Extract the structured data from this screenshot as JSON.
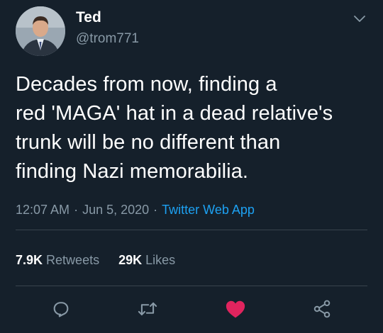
{
  "user": {
    "display_name": "Ted",
    "handle": "@trom771"
  },
  "tweet": {
    "text": "Decades from now, finding a\nred 'MAGA' hat in a dead relative's\ntrunk will be no different than\nfinding Nazi memorabilia.",
    "time": "12:07 AM",
    "separator": "·",
    "date": "Jun 5, 2020",
    "source": "Twitter Web App"
  },
  "stats": {
    "retweets_count": "7.9K",
    "retweets_label": "Retweets",
    "likes_count": "29K",
    "likes_label": "Likes"
  },
  "actions": [
    {
      "icon": "reply-icon"
    },
    {
      "icon": "retweet-icon"
    },
    {
      "icon": "like-heart-icon",
      "state": "liked"
    },
    {
      "icon": "share-icon"
    }
  ],
  "colors": {
    "background": "#15202b",
    "text_primary": "#ffffff",
    "text_secondary": "#8899a6",
    "link": "#1da1f2",
    "like": "#e0245e",
    "divider": "#38444d"
  }
}
